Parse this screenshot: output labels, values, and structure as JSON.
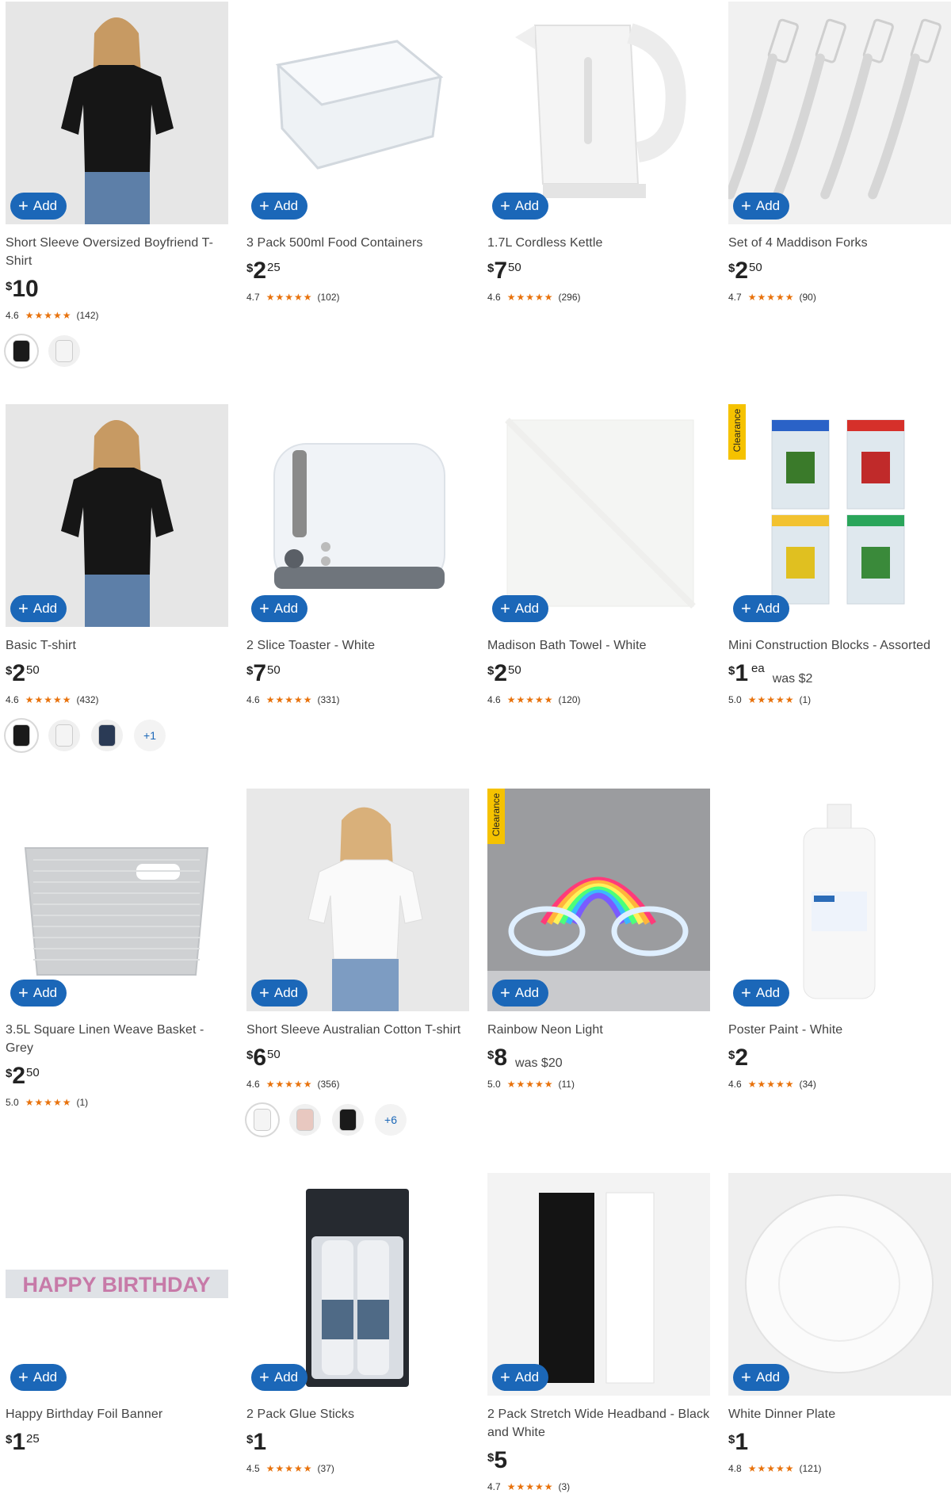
{
  "add_label": "Add",
  "products": [
    {
      "name": "Short Sleeve Oversized Boyfriend T-Shirt",
      "dollars": "10",
      "cents": "",
      "rating": "4.6",
      "stars": "★★★★★",
      "reviews": "(142)",
      "swatches": [
        "#1a1a1a",
        "#f4f4f4"
      ],
      "swatch_more": "",
      "icon": "black-tshirt-image"
    },
    {
      "name": "3 Pack 500ml Food Containers",
      "dollars": "2",
      "cents": "25",
      "rating": "4.7",
      "stars": "★★★★★",
      "reviews": "(102)",
      "icon": "food-container-image"
    },
    {
      "name": "1.7L Cordless Kettle",
      "dollars": "7",
      "cents": "50",
      "rating": "4.6",
      "stars": "★★★★★",
      "reviews": "(296)",
      "icon": "kettle-image"
    },
    {
      "name": "Set of 4 Maddison Forks",
      "dollars": "2",
      "cents": "50",
      "rating": "4.7",
      "stars": "★★★★★",
      "reviews": "(90)",
      "icon": "forks-image"
    },
    {
      "name": "Basic T-shirt",
      "dollars": "2",
      "cents": "50",
      "rating": "4.6",
      "stars": "★★★★★",
      "reviews": "(432)",
      "swatches": [
        "#1a1a1a",
        "#f4f4f4",
        "#2a3a55"
      ],
      "swatch_more": "+1",
      "icon": "black-tshirt-image"
    },
    {
      "name": "2 Slice Toaster - White",
      "dollars": "7",
      "cents": "50",
      "rating": "4.6",
      "stars": "★★★★★",
      "reviews": "(331)",
      "icon": "toaster-image"
    },
    {
      "name": "Madison Bath Towel - White",
      "dollars": "2",
      "cents": "50",
      "rating": "4.6",
      "stars": "★★★★★",
      "reviews": "(120)",
      "icon": "towel-image"
    },
    {
      "name": "Mini Construction Blocks - Assorted",
      "dollars": "1",
      "cents": "",
      "ea": "ea",
      "was": "was $2",
      "rating": "5.0",
      "stars": "★★★★★",
      "reviews": "(1)",
      "badge": "Clearance",
      "icon": "construction-blocks-image"
    },
    {
      "name": "3.5L Square Linen Weave Basket - Grey",
      "dollars": "2",
      "cents": "50",
      "rating": "5.0",
      "stars": "★★★★★",
      "reviews": "(1)",
      "icon": "basket-image"
    },
    {
      "name": "Short Sleeve Australian Cotton T-shirt",
      "dollars": "6",
      "cents": "50",
      "rating": "4.6",
      "stars": "★★★★★",
      "reviews": "(356)",
      "swatches": [
        "#f4f4f4",
        "#e8c8c0",
        "#1a1a1a"
      ],
      "swatch_more": "+6",
      "icon": "white-tshirt-image"
    },
    {
      "name": "Rainbow Neon Light",
      "dollars": "8",
      "cents": "",
      "was": "was $20",
      "rating": "5.0",
      "stars": "★★★★★",
      "reviews": "(11)",
      "badge": "Clearance",
      "icon": "rainbow-neon-image"
    },
    {
      "name": "Poster Paint - White",
      "dollars": "2",
      "cents": "",
      "rating": "4.6",
      "stars": "★★★★★",
      "reviews": "(34)",
      "icon": "paint-bottle-image"
    },
    {
      "name": "Happy Birthday Foil Banner",
      "dollars": "1",
      "cents": "25",
      "rating": "",
      "stars": "",
      "reviews": "",
      "icon": "birthday-banner-image",
      "banner_text": "HAPPY BIRTHDAY"
    },
    {
      "name": "2 Pack Glue Sticks",
      "dollars": "1",
      "cents": "",
      "rating": "4.5",
      "stars": "★★★★★",
      "reviews": "(37)",
      "icon": "glue-sticks-image"
    },
    {
      "name": "2 Pack Stretch Wide Headband - Black and White",
      "dollars": "5",
      "cents": "",
      "rating": "4.7",
      "stars": "★★★★★",
      "reviews": "(3)",
      "icon": "headband-image"
    },
    {
      "name": "White Dinner Plate",
      "dollars": "1",
      "cents": "",
      "rating": "4.8",
      "stars": "★★★★★",
      "reviews": "(121)",
      "icon": "plate-image"
    }
  ]
}
